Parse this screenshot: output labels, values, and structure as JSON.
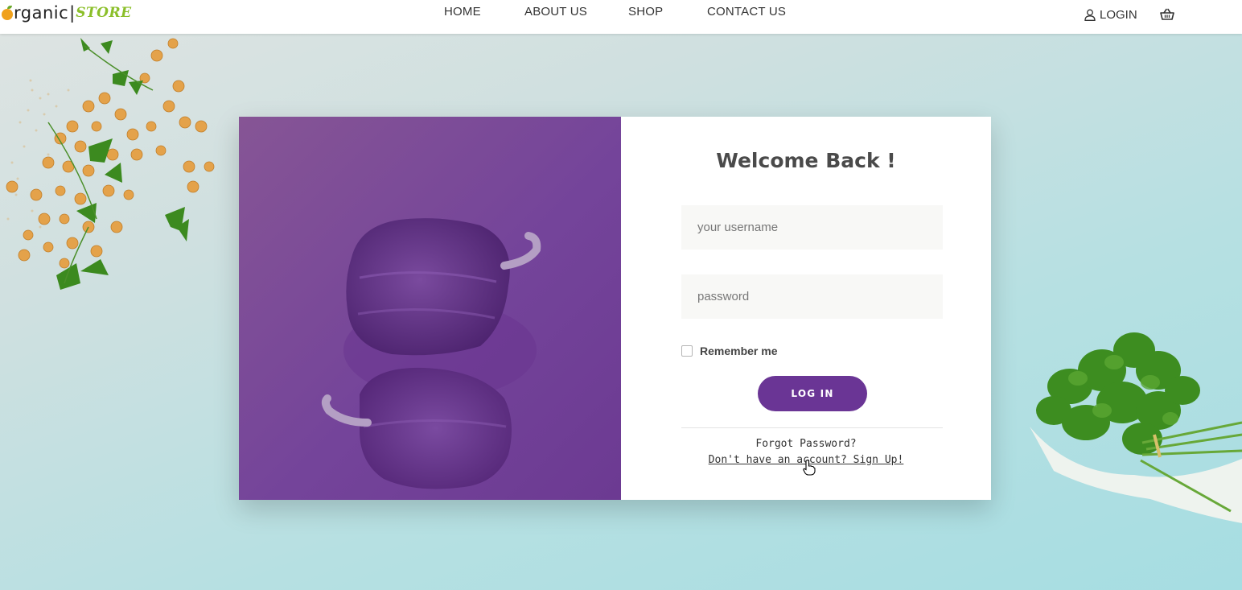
{
  "header": {
    "logo": {
      "word1": "rganic",
      "separator": "|",
      "word2": "STORE"
    },
    "nav": [
      {
        "label": "HOME"
      },
      {
        "label": "ABOUT US"
      },
      {
        "label": "SHOP"
      },
      {
        "label": "CONTACT US"
      }
    ],
    "login_label": "LOGIN",
    "icons": {
      "login": "user-icon",
      "cart": "basket-icon"
    }
  },
  "login_form": {
    "title": "Welcome Back !",
    "username": {
      "placeholder": "your username",
      "value": ""
    },
    "password": {
      "placeholder": "password",
      "value": ""
    },
    "remember_label": "Remember me",
    "remember_checked": false,
    "submit_label": "LOG IN",
    "forgot_label": "Forgot Password?",
    "signup_label": "Don't have an account? Sign Up!"
  },
  "colors": {
    "accent_purple": "#6a3595",
    "logo_green": "#8bbf2a",
    "logo_orange": "#f0a11c"
  }
}
